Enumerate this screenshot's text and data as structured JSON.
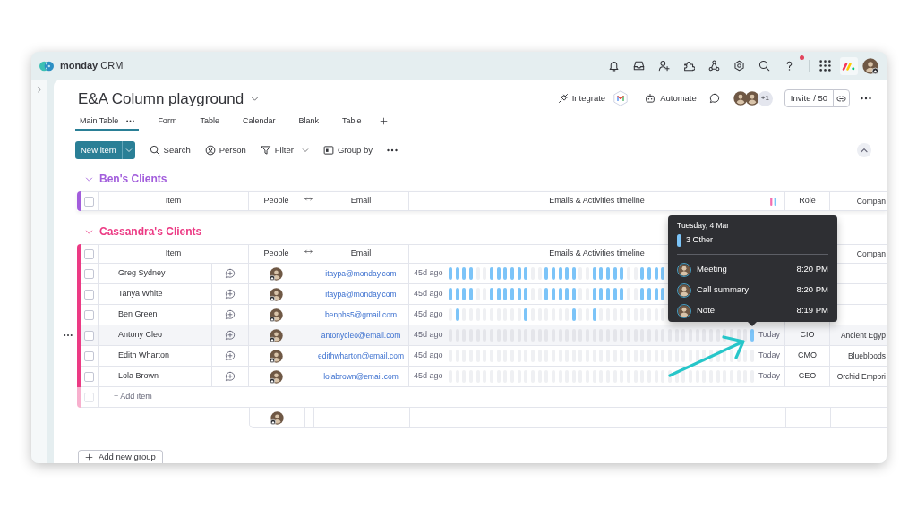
{
  "app": {
    "logo_text": "**monday** CRM",
    "notification_dot": true
  },
  "board": {
    "title": "E&A Column playground",
    "views": [
      {
        "label": "Main Table",
        "selected": true
      },
      {
        "label": "Form",
        "selected": false
      },
      {
        "label": "Table",
        "selected": false
      },
      {
        "label": "Calendar",
        "selected": false
      },
      {
        "label": "Blank",
        "selected": false
      },
      {
        "label": "Table",
        "selected": false
      }
    ],
    "actions": {
      "integrate": "Integrate",
      "automate": "Automate",
      "extra_members": "+1",
      "invite": "Invite / 50"
    }
  },
  "toolbar": {
    "new_item": "New item",
    "tools": [
      {
        "kind": "search",
        "label": "Search",
        "dropdown": false
      },
      {
        "kind": "person",
        "label": "Person",
        "dropdown": false
      },
      {
        "kind": "filter",
        "label": "Filter",
        "dropdown": true
      },
      {
        "kind": "group_by",
        "label": "Group by",
        "dropdown": false
      }
    ]
  },
  "groups": [
    {
      "title": "Ben's Clients",
      "color": "#a25ddc",
      "expanded": true,
      "select_all": false,
      "legend_icon": true,
      "columns": {
        "item": "Item",
        "people": "People",
        "email": "Email",
        "timeline": "Emails & Activities timeline",
        "role": "Role",
        "company": "Compan"
      }
    },
    {
      "title": "Cassandra's Clients",
      "color": "#ec3a84",
      "expanded": true,
      "select_all": false,
      "columns": {
        "item": "Item",
        "people": "People",
        "email": "Email",
        "timeline": "Emails & Activities timeline",
        "company": "Compan"
      },
      "rows": [
        {
          "name": "Greg Sydney",
          "email": "itaypa@monday.com",
          "last_activity": "45d ago",
          "checked": false,
          "highlighted": false,
          "segments": [
            true,
            true,
            true,
            true,
            false,
            false,
            true,
            true,
            true,
            true,
            true,
            true,
            false,
            false,
            true,
            true,
            true,
            true,
            true,
            false,
            false,
            true,
            true,
            true,
            true,
            true,
            false,
            false,
            true,
            true,
            true,
            true
          ]
        },
        {
          "name": "Tanya White",
          "email": "itaypa@monday.com",
          "last_activity": "45d ago",
          "checked": false,
          "highlighted": false,
          "segments": [
            true,
            true,
            true,
            true,
            false,
            false,
            true,
            true,
            true,
            true,
            true,
            true,
            false,
            false,
            true,
            true,
            true,
            true,
            true,
            false,
            false,
            true,
            true,
            true,
            true,
            true,
            false,
            false,
            true,
            true,
            true,
            true
          ]
        },
        {
          "name": "Ben Green",
          "email": "benphs5@gmail.com",
          "last_activity": "45d ago",
          "checked": false,
          "highlighted": false,
          "segments": [
            false,
            true,
            false,
            false,
            false,
            false,
            false,
            false,
            false,
            false,
            false,
            true,
            false,
            false,
            false,
            false,
            false,
            false,
            true,
            false,
            false,
            true,
            false,
            false,
            false,
            false,
            false,
            false,
            false,
            false,
            false,
            false
          ]
        },
        {
          "name": "Antony Cleo",
          "email": "antonycleo@email.com",
          "last_activity": "45d ago",
          "latest": "Today",
          "role": "CIO",
          "company": "Ancient Egyp",
          "checked": false,
          "highlighted": true,
          "segments": [
            false,
            false,
            false,
            false,
            false,
            false,
            false,
            false,
            false,
            false,
            false,
            false,
            false,
            false,
            false,
            false,
            false,
            false,
            false,
            false,
            false,
            false,
            false,
            false,
            false,
            false,
            false,
            false,
            false,
            false,
            false,
            false,
            false,
            false,
            false,
            false,
            false,
            false,
            false,
            false,
            false,
            false,
            false,
            false,
            true
          ]
        },
        {
          "name": "Edith Wharton",
          "email": "edithwharton@email.com",
          "last_activity": "45d ago",
          "latest": "Today",
          "role": "CMO",
          "company": "Bluebloods",
          "checked": false,
          "highlighted": false,
          "segments": [
            false,
            false,
            false,
            false,
            false,
            false,
            false,
            false,
            false,
            false,
            false,
            false,
            false,
            false,
            false,
            false,
            false,
            false,
            false,
            false,
            false,
            false,
            false,
            false,
            false,
            false,
            false,
            false,
            false,
            false,
            false,
            false,
            false,
            false,
            false,
            false,
            false,
            false,
            false,
            false,
            false,
            false,
            false,
            false,
            false
          ]
        },
        {
          "name": "Lola Brown",
          "email": "lolabrown@email.com",
          "last_activity": "45d ago",
          "latest": "Today",
          "role": "CEO",
          "company": "Orchid Empori",
          "checked": false,
          "highlighted": false,
          "segments": [
            false,
            false,
            false,
            false,
            false,
            false,
            false,
            false,
            false,
            false,
            false,
            false,
            false,
            false,
            false,
            false,
            false,
            false,
            false,
            false,
            false,
            false,
            false,
            false,
            false,
            false,
            false,
            false,
            false,
            false,
            false,
            false,
            false,
            false,
            false,
            false,
            false,
            false,
            false,
            false,
            false,
            false,
            false,
            false,
            false
          ]
        }
      ],
      "add_item": {
        "label": "+ Add item",
        "checked": false,
        "disabled": true
      }
    }
  ],
  "tooltip": {
    "date": "Tuesday, 4 Mar",
    "summary": "3 Other",
    "activities": [
      {
        "label": "Meeting",
        "time": "8:20 PM"
      },
      {
        "label": "Call summary",
        "time": "8:20 PM"
      },
      {
        "label": "Note",
        "time": "8:19 PM"
      }
    ]
  },
  "add_group": "Add new group"
}
